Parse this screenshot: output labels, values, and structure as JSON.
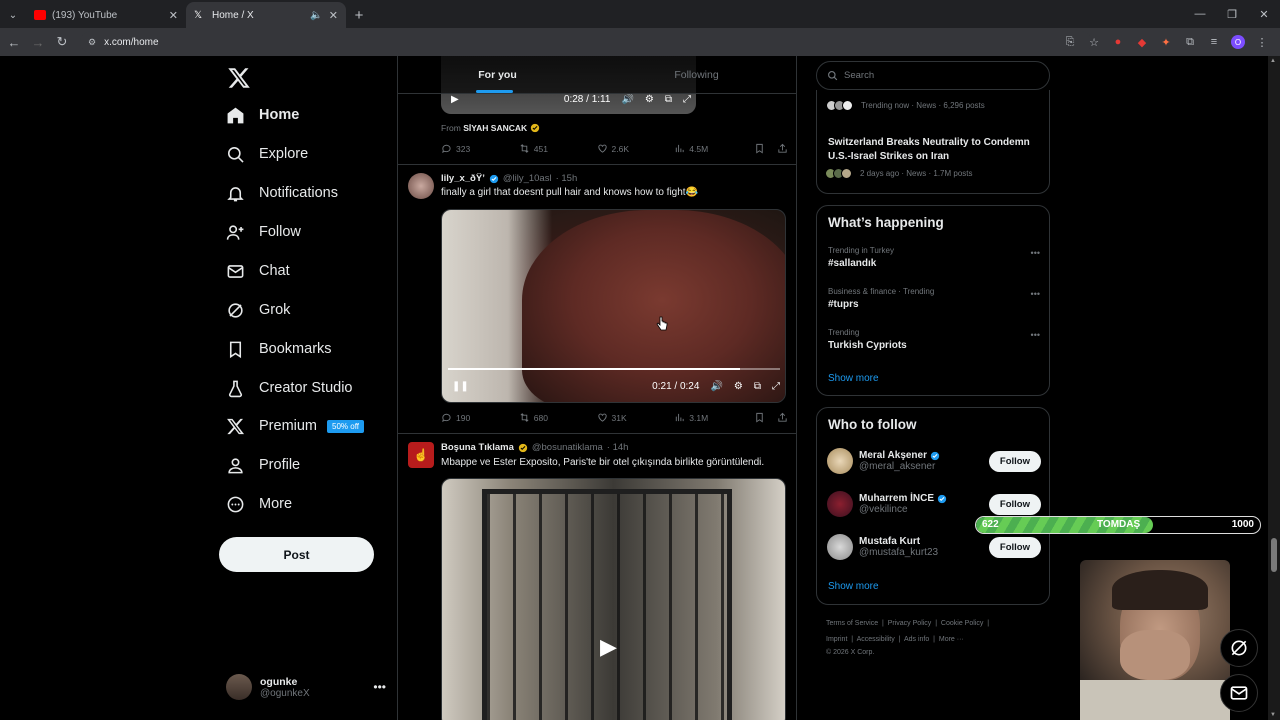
{
  "browser": {
    "tabs": [
      {
        "title": "(193) YouTube",
        "active": false
      },
      {
        "title": "Home / X",
        "active": true
      }
    ],
    "url": "x.com/home",
    "profile_initial": "O"
  },
  "nav": {
    "items": [
      {
        "label": "Home"
      },
      {
        "label": "Explore"
      },
      {
        "label": "Notifications"
      },
      {
        "label": "Follow"
      },
      {
        "label": "Chat"
      },
      {
        "label": "Grok"
      },
      {
        "label": "Bookmarks"
      },
      {
        "label": "Creator Studio"
      },
      {
        "label": "Premium"
      },
      {
        "label": "Profile"
      },
      {
        "label": "More"
      }
    ],
    "premium_badge": "50% off",
    "post_label": "Post",
    "user": {
      "name": "ogunke",
      "handle": "@ogunkeX"
    }
  },
  "feed": {
    "tabs": [
      "For you",
      "Following"
    ],
    "prev": {
      "time": "0:28 / 1:11",
      "from_prefix": "From",
      "from_name": "SİYAH SANCAK",
      "replies": "323",
      "reposts": "451",
      "likes": "2.6K",
      "views": "4.5M"
    },
    "tweet1": {
      "name": "lily_x_ðŸ’",
      "handle": "@lily_10asl",
      "time": "· 15h",
      "text": "finally a girl that doesnt pull hair and knows how to fight😂",
      "video_time": "0:21 / 0:24",
      "progress": 0.88,
      "replies": "190",
      "reposts": "680",
      "likes": "31K",
      "views": "3.1M"
    },
    "tweet2": {
      "name": "Boşuna Tıklama",
      "handle": "@bosunatiklama",
      "time": "· 14h",
      "text": "Mbappe ve Ester Exposito, Paris'te bir otel çıkışında birlikte görüntülendi."
    }
  },
  "right": {
    "search_placeholder": "Search",
    "news": [
      {
        "meta": "Trending now · News · 6,296 posts"
      },
      {
        "title": "Switzerland Breaks Neutrality to Condemn U.S.-Israel Strikes on Iran",
        "meta": "2 days ago · News · 1.7M posts"
      }
    ],
    "happening": {
      "title": "What’s happening",
      "items": [
        {
          "context": "Trending in Turkey",
          "tag": "#sallandık"
        },
        {
          "context": "Business & finance · Trending",
          "tag": "#tuprs"
        },
        {
          "context": "Trending",
          "tag": "Turkish Cypriots"
        }
      ],
      "show_more": "Show more"
    },
    "who": {
      "title": "Who to follow",
      "people": [
        {
          "name": "Meral Akşener",
          "handle": "@meral_aksener",
          "verified": true
        },
        {
          "name": "Muharrem İNCE",
          "handle": "@vekilince",
          "verified": true
        },
        {
          "name": "Mustafa Kurt",
          "handle": "@mustafa_kurt23",
          "verified": false
        }
      ],
      "follow_label": "Follow",
      "show_more": "Show more"
    },
    "footer": {
      "links": [
        "Terms of Service",
        "Privacy Policy",
        "Cookie Policy",
        "Imprint",
        "Accessibility",
        "Ads info",
        "More ···"
      ],
      "copyright": "© 2026 X Corp."
    }
  },
  "overlay": {
    "current": "622",
    "label": "TOMDAŞ",
    "max": "1000",
    "progress": 0.622
  },
  "colors": {
    "accent": "#1d9bf0",
    "bg": "#000000",
    "text": "#e7e9ea",
    "muted": "#71767b"
  }
}
